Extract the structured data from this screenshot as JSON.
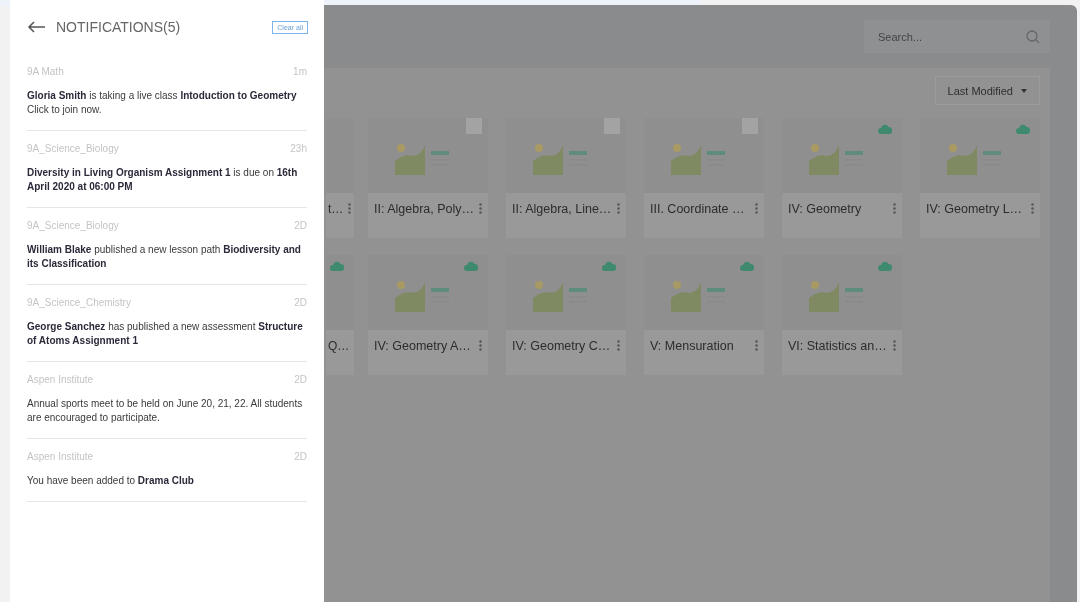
{
  "notifications": {
    "title": "NOTIFICATIONS(5)",
    "clear_button": "Clear all",
    "items": [
      {
        "source": "9A Math",
        "time": "1m",
        "message": "**Gloria Smith** is taking a live class **Intoduction to Geometry** Click to join now."
      },
      {
        "source": "9A_Science_Biology",
        "time": "23h",
        "message": "**Diversity in Living Organism Assignment 1** is due on **16th April 2020 at 06:00 PM**"
      },
      {
        "source": "9A_Science_Biology",
        "time": "2D",
        "message": "**William Blake** published a new lesson path **Biodiversity and its Classification**"
      },
      {
        "source": "9A_Science_Chemistry",
        "time": "2D",
        "message": "**George Sanchez** has published a new assessment **Structure of Atoms Assignment 1**"
      },
      {
        "source": "Aspen Institute",
        "time": "2D",
        "message": "Annual sports meet to be held on June 20, 21, 22. All students are encouraged to participate."
      },
      {
        "source": "Aspen Institute",
        "time": "2D",
        "message": "You have been added to **Drama Club**"
      }
    ]
  },
  "search": {
    "placeholder": "Search..."
  },
  "sort_button": "Last Modified",
  "card_rows": [
    [
      {
        "title": "t…",
        "synced": false,
        "partial": true
      },
      {
        "title": "II: Algebra, Poly…",
        "synced": false,
        "partial": false
      },
      {
        "title": "II: Algebra, Line…",
        "synced": false,
        "partial": false
      },
      {
        "title": "III. Coordinate …",
        "synced": false,
        "partial": false
      },
      {
        "title": "IV: Geometry",
        "synced": true,
        "partial": false
      },
      {
        "title": "IV: Geometry L…",
        "synced": true,
        "partial": false
      }
    ],
    [
      {
        "title": "Q…",
        "synced": true,
        "partial": true
      },
      {
        "title": "IV: Geometry A…",
        "synced": true,
        "partial": false
      },
      {
        "title": "IV: Geometry C…",
        "synced": true,
        "partial": false
      },
      {
        "title": "V: Mensuration",
        "synced": true,
        "partial": false
      },
      {
        "title": "VI: Statistics an…",
        "synced": true,
        "partial": false
      }
    ]
  ]
}
